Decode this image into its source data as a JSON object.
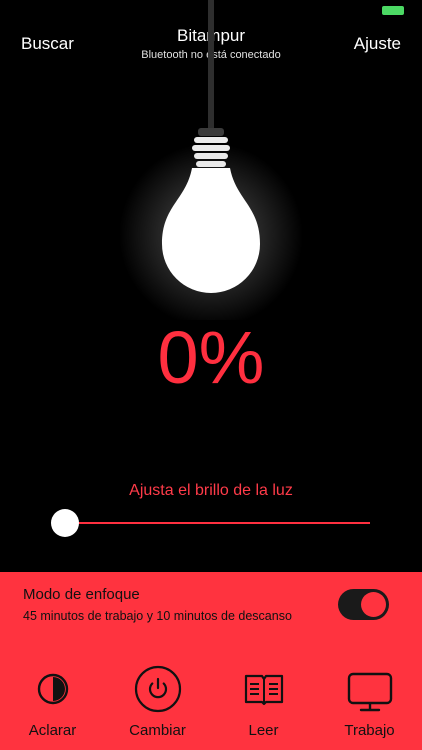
{
  "header": {
    "search_label": "Buscar",
    "settings_label": "Ajuste",
    "title": "Bitampur",
    "subtitle": "Bluetooth no está conectado"
  },
  "brightness": {
    "percent_text": "0%",
    "value": 0,
    "slider_label": "Ajusta el brillo de la luz"
  },
  "focus": {
    "title": "Modo de enfoque",
    "description": "45 minutos de trabajo y 10 minutos de descanso",
    "enabled": true
  },
  "tabs": [
    {
      "label": "Aclarar",
      "icon": "contrast-icon"
    },
    {
      "label": "Cambiar",
      "icon": "power-icon"
    },
    {
      "label": "Leer",
      "icon": "book-icon"
    },
    {
      "label": "Trabajo",
      "icon": "monitor-icon"
    }
  ],
  "colors": {
    "accent": "#ff333f",
    "background": "#000000",
    "battery": "#4cd964"
  }
}
